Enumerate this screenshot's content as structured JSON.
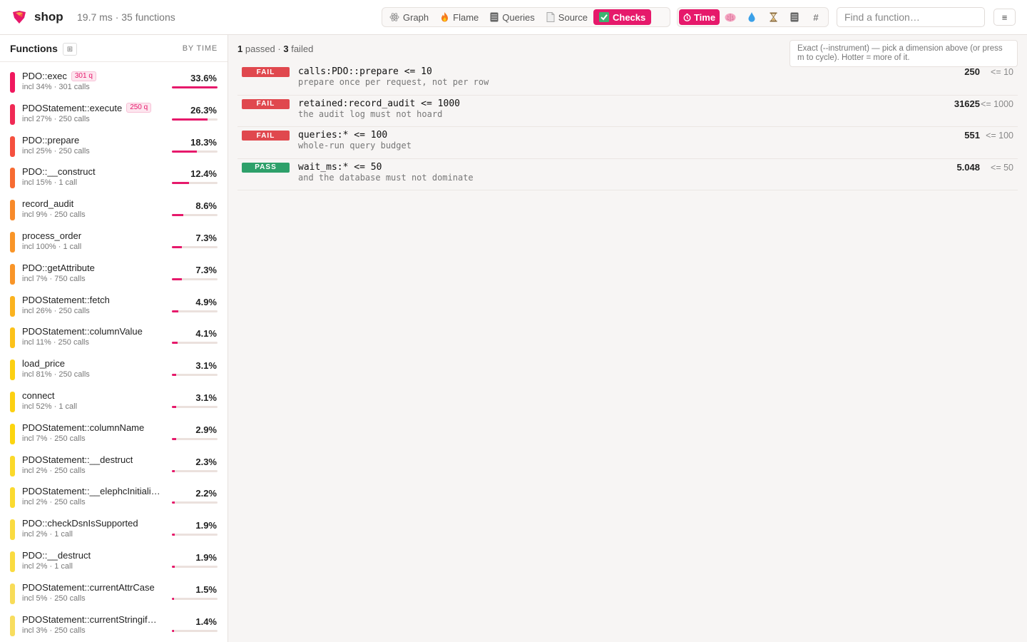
{
  "app": {
    "name": "shop",
    "meta": "19.7 ms · 35 functions"
  },
  "view_tabs": [
    {
      "label": "Graph",
      "icon": "atom-icon",
      "active": false
    },
    {
      "label": "Flame",
      "icon": "flame-icon",
      "active": false
    },
    {
      "label": "Queries",
      "icon": "database-icon",
      "active": false
    },
    {
      "label": "Source",
      "icon": "file-icon",
      "active": false
    },
    {
      "label": "Checks",
      "icon": "check-box-icon",
      "active": true
    }
  ],
  "dimensions": [
    {
      "label": "Time",
      "icon": "stopwatch-icon",
      "active": true
    },
    {
      "label": "",
      "icon": "brain-icon",
      "active": false
    },
    {
      "label": "",
      "icon": "droplet-icon",
      "active": false
    },
    {
      "label": "",
      "icon": "hourglass-icon",
      "active": false
    },
    {
      "label": "",
      "icon": "database-icon",
      "active": false
    },
    {
      "label": "#",
      "icon": "",
      "active": false
    }
  ],
  "search": {
    "placeholder": "Find a function…",
    "value": ""
  },
  "menu": {
    "label": "≡"
  },
  "sidebar": {
    "title": "Functions",
    "toggle_label": "⊞",
    "sort_label": "BY TIME",
    "functions": [
      {
        "name": "PDO::exec",
        "badge": "301 q",
        "sub": "incl 34% · 301 calls",
        "pct_label": "33.6%",
        "pct": 33.6,
        "heat": "#f0185e"
      },
      {
        "name": "PDOStatement::execute",
        "badge": "250 q",
        "sub": "incl 27% · 250 calls",
        "pct_label": "26.3%",
        "pct": 26.3,
        "heat": "#f02a55"
      },
      {
        "name": "PDO::prepare",
        "badge": "",
        "sub": "incl 25% · 250 calls",
        "pct_label": "18.3%",
        "pct": 18.3,
        "heat": "#f5503f"
      },
      {
        "name": "PDO::__construct",
        "badge": "",
        "sub": "incl 15% · 1 call",
        "pct_label": "12.4%",
        "pct": 12.4,
        "heat": "#f76b32"
      },
      {
        "name": "record_audit",
        "badge": "",
        "sub": "incl 9% · 250 calls",
        "pct_label": "8.6%",
        "pct": 8.6,
        "heat": "#f88a2a"
      },
      {
        "name": "process_order",
        "badge": "",
        "sub": "incl 100% · 1 call",
        "pct_label": "7.3%",
        "pct": 7.3,
        "heat": "#f99528"
      },
      {
        "name": "PDO::getAttribute",
        "badge": "",
        "sub": "incl 7% · 750 calls",
        "pct_label": "7.3%",
        "pct": 7.3,
        "heat": "#f99528"
      },
      {
        "name": "PDOStatement::fetch",
        "badge": "",
        "sub": "incl 26% · 250 calls",
        "pct_label": "4.9%",
        "pct": 4.9,
        "heat": "#fbb31f"
      },
      {
        "name": "PDOStatement::columnValue",
        "badge": "",
        "sub": "incl 11% · 250 calls",
        "pct_label": "4.1%",
        "pct": 4.1,
        "heat": "#fcc21a"
      },
      {
        "name": "load_price",
        "badge": "",
        "sub": "incl 81% · 250 calls",
        "pct_label": "3.1%",
        "pct": 3.1,
        "heat": "#fcd012"
      },
      {
        "name": "connect",
        "badge": "",
        "sub": "incl 52% · 1 call",
        "pct_label": "3.1%",
        "pct": 3.1,
        "heat": "#fcd012"
      },
      {
        "name": "PDOStatement::columnName",
        "badge": "",
        "sub": "incl 7% · 250 calls",
        "pct_label": "2.9%",
        "pct": 2.9,
        "heat": "#fcd50f"
      },
      {
        "name": "PDOStatement::__destruct",
        "badge": "",
        "sub": "incl 2% · 250 calls",
        "pct_label": "2.3%",
        "pct": 2.3,
        "heat": "#fbd92a"
      },
      {
        "name": "PDOStatement::__elephcInitiali…",
        "badge": "",
        "sub": "incl 2% · 250 calls",
        "pct_label": "2.2%",
        "pct": 2.2,
        "heat": "#fbda30"
      },
      {
        "name": "PDO::checkDsnIsSupported",
        "badge": "",
        "sub": "incl 2% · 1 call",
        "pct_label": "1.9%",
        "pct": 1.9,
        "heat": "#fadb40"
      },
      {
        "name": "PDO::__destruct",
        "badge": "",
        "sub": "incl 2% · 1 call",
        "pct_label": "1.9%",
        "pct": 1.9,
        "heat": "#fadb40"
      },
      {
        "name": "PDOStatement::currentAttrCase",
        "badge": "",
        "sub": "incl 5% · 250 calls",
        "pct_label": "1.5%",
        "pct": 1.5,
        "heat": "#f8dc58"
      },
      {
        "name": "PDOStatement::currentStringif…",
        "badge": "",
        "sub": "incl 3% · 250 calls",
        "pct_label": "1.4%",
        "pct": 1.4,
        "heat": "#f8dd5e"
      }
    ]
  },
  "main": {
    "summary": {
      "passed_count": "1",
      "passed_label": "passed ·",
      "failed_count": "3",
      "failed_label": "failed"
    },
    "hint": "Exact (--instrument) — pick a dimension above (or press m to cycle). Hotter = more of it.",
    "checks": [
      {
        "status": "FAIL",
        "expr": "calls:PDO::prepare <= 10",
        "note": "prepare once per request, not per row",
        "actual": "250",
        "limit": "<= 10"
      },
      {
        "status": "FAIL",
        "expr": "retained:record_audit <= 1000",
        "note": "the audit log must not hoard",
        "actual": "31625",
        "limit": "<= 1000"
      },
      {
        "status": "FAIL",
        "expr": "queries:* <= 100",
        "note": "whole-run query budget",
        "actual": "551",
        "limit": "<= 100"
      },
      {
        "status": "PASS",
        "expr": "wait_ms:* <= 50",
        "note": "and the database must not dominate",
        "actual": "5.048",
        "limit": "<= 50"
      }
    ]
  },
  "colors": {
    "accent": "#e6196b",
    "fail": "#e0484e",
    "pass": "#2ea06a"
  }
}
